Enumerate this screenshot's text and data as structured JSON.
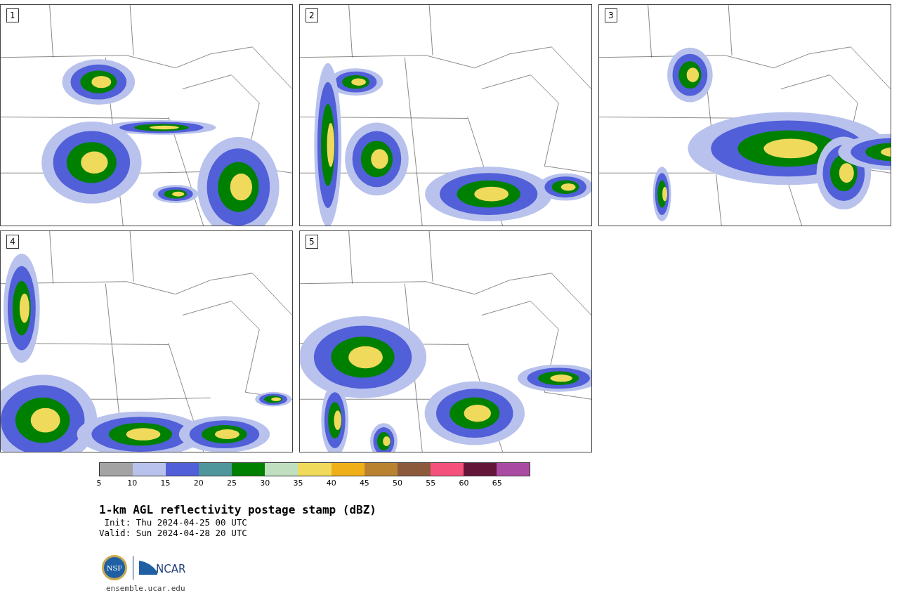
{
  "panels": [
    {
      "label": "1",
      "kind": "map-picture"
    },
    {
      "label": "2",
      "kind": "map-picture"
    },
    {
      "label": "3",
      "kind": "map-picture"
    },
    {
      "label": "4",
      "kind": "map-picture"
    },
    {
      "label": "5",
      "kind": "map-picture"
    }
  ],
  "colorbar": {
    "segments": [
      {
        "tick": "5",
        "color": "#a3a3a3"
      },
      {
        "tick": "10",
        "color": "#b8c2ed"
      },
      {
        "tick": "15",
        "color": "#515fd8"
      },
      {
        "tick": "20",
        "color": "#4f959c"
      },
      {
        "tick": "25",
        "color": "#008000"
      },
      {
        "tick": "30",
        "color": "#bfdfbf"
      },
      {
        "tick": "35",
        "color": "#f0da5c"
      },
      {
        "tick": "40",
        "color": "#efaf18"
      },
      {
        "tick": "45",
        "color": "#b98230"
      },
      {
        "tick": "50",
        "color": "#8b5a3c"
      },
      {
        "tick": "55",
        "color": "#f4527c"
      },
      {
        "tick": "60",
        "color": "#631637"
      },
      {
        "tick": "65",
        "color": "#aa4ba3"
      }
    ]
  },
  "title": "1-km AGL reflectivity postage stamp (dBZ)",
  "init": " Init: Thu 2024-04-25 00 UTC",
  "valid": "Valid: Sun 2024-04-28 20 UTC",
  "logos": {
    "nsf": "NSF",
    "ncar": "NCAR"
  },
  "url": "ensemble.ucar.edu"
}
